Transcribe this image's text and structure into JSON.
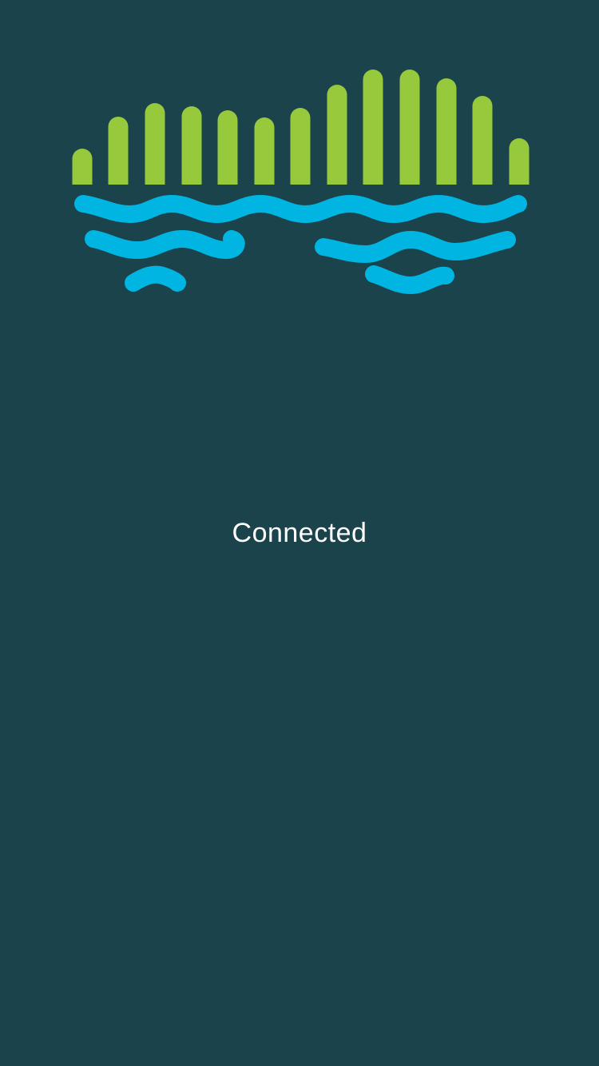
{
  "logo": {
    "icon": "sound-waves-logo-icon",
    "bar_color": "#97c93d",
    "wave_color": "#00b5e2"
  },
  "status": {
    "text": "Connected"
  },
  "colors": {
    "background": "#1a434c",
    "text": "#ffffff"
  }
}
